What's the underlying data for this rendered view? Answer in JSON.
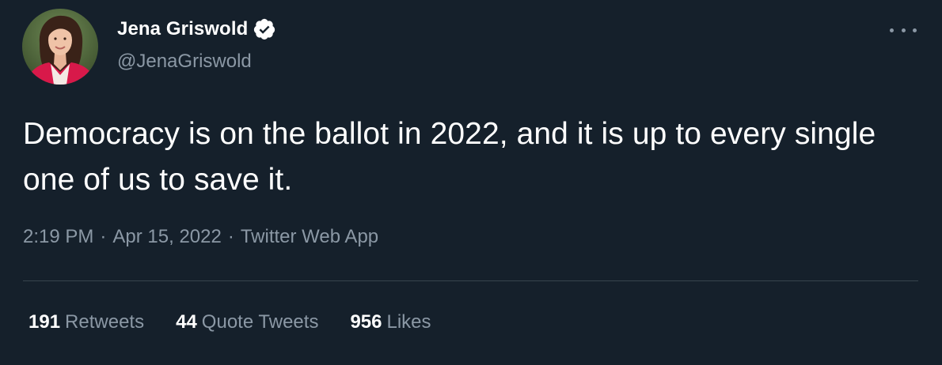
{
  "author": {
    "display_name": "Jena Griswold",
    "handle": "@JenaGriswold",
    "verified": true,
    "avatar_icon": "profile-photo-icon"
  },
  "tweet": {
    "text": "Democracy is on the ballot in 2022, and it is up to every single one of us to save it.",
    "time": "2:19 PM",
    "date": "Apr 15, 2022",
    "source": "Twitter Web App",
    "separator": "·"
  },
  "stats": {
    "retweets_count": "191",
    "retweets_label": "Retweets",
    "quotes_count": "44",
    "quotes_label": "Quote Tweets",
    "likes_count": "956",
    "likes_label": "Likes"
  },
  "colors": {
    "background": "#15202b",
    "primary_text": "#ffffff",
    "secondary_text": "#8b98a5",
    "divider": "#38444d"
  }
}
